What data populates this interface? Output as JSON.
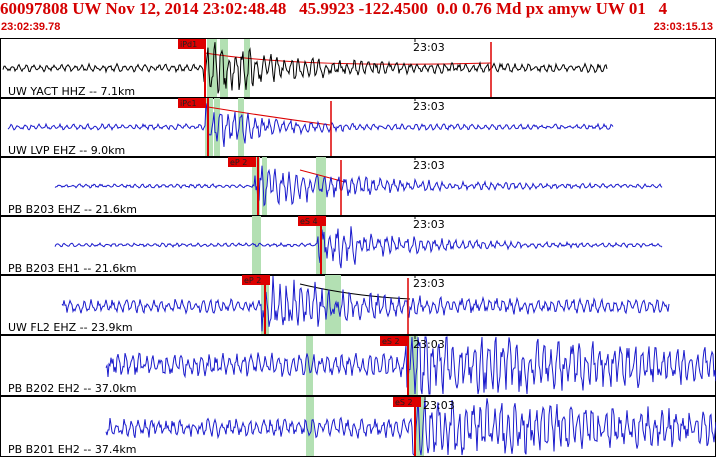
{
  "header": {
    "title": "60097808 UW Nov 12, 2014 23:02:48.48   45.9923 -122.4500  0.0 0.76 Md px amyw UW 01   4",
    "time_start": "23:02:39.78",
    "time_end": "23:03:15.13"
  },
  "colors": {
    "header_text": "#d40000",
    "trace_first": "#000000",
    "trace": "#1a1acc",
    "pick": "#dd0000",
    "window": "#b3e0b3",
    "coda": "#dd0000"
  },
  "minute_label": "23:03",
  "panels": [
    {
      "channel": "UW YACT HHZ -- 7.1km",
      "pick": "iPd1",
      "color": "black"
    },
    {
      "channel": "UW LVP EHZ -- 9.0km",
      "pick": "iPc1",
      "color": "blue"
    },
    {
      "channel": "PB B203 EHZ -- 21.6km",
      "pick": "eP 2",
      "color": "blue"
    },
    {
      "channel": "PB B203 EH1 -- 21.6km",
      "pick": "eS 4",
      "color": "blue"
    },
    {
      "channel": "UW FL2 EHZ -- 23.9km",
      "pick": "eP 2",
      "color": "blue"
    },
    {
      "channel": "PB B202 EH2 -- 37.0km",
      "pick": "eS 2",
      "color": "blue"
    },
    {
      "channel": "PB B201 EH2 -- 37.4km",
      "pick": "eS 2",
      "color": "blue"
    }
  ]
}
